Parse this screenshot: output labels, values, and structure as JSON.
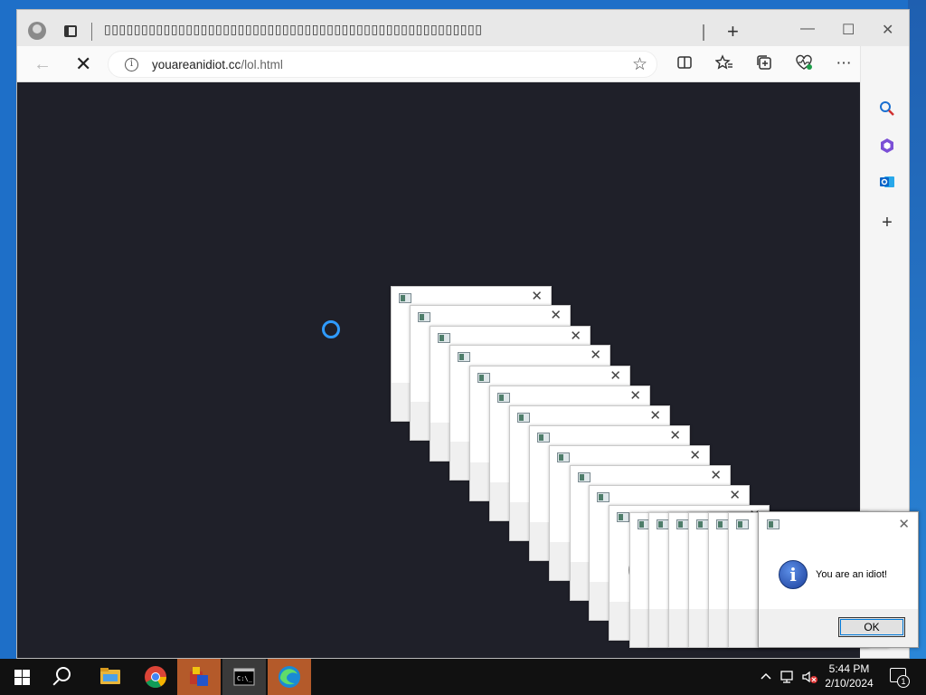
{
  "browser": {
    "tab_title": "▯▯▯▯▯▯▯▯▯▯▯▯▯▯▯▯▯▯▯▯▯▯▯▯▯▯▯▯▯▯▯▯▯▯▯▯▯▯▯▯▯▯▯▯▯▯▯▯▯▯▯",
    "new_tab_label": "+",
    "minimize_label": "—",
    "maximize_label": "☐",
    "close_label": "✕",
    "back_label": "←",
    "stop_label": "✕",
    "url_host": "youareanidiot.cc",
    "url_path": "/lol.html",
    "favorite_label": "☆"
  },
  "dialog": {
    "message": "You are an idiot!",
    "ok_label": "OK",
    "close_label": "✕",
    "info_label": "i"
  },
  "taskbar": {
    "time": "5:44 PM",
    "date": "2/10/2024",
    "notification_count": "1",
    "apps": [
      "file-explorer",
      "chrome",
      "app-installer",
      "command-prompt",
      "edge"
    ]
  },
  "colors": {
    "page_background": "#1f2029",
    "taskbar": "#111111",
    "spinner": "#2f9bff"
  }
}
